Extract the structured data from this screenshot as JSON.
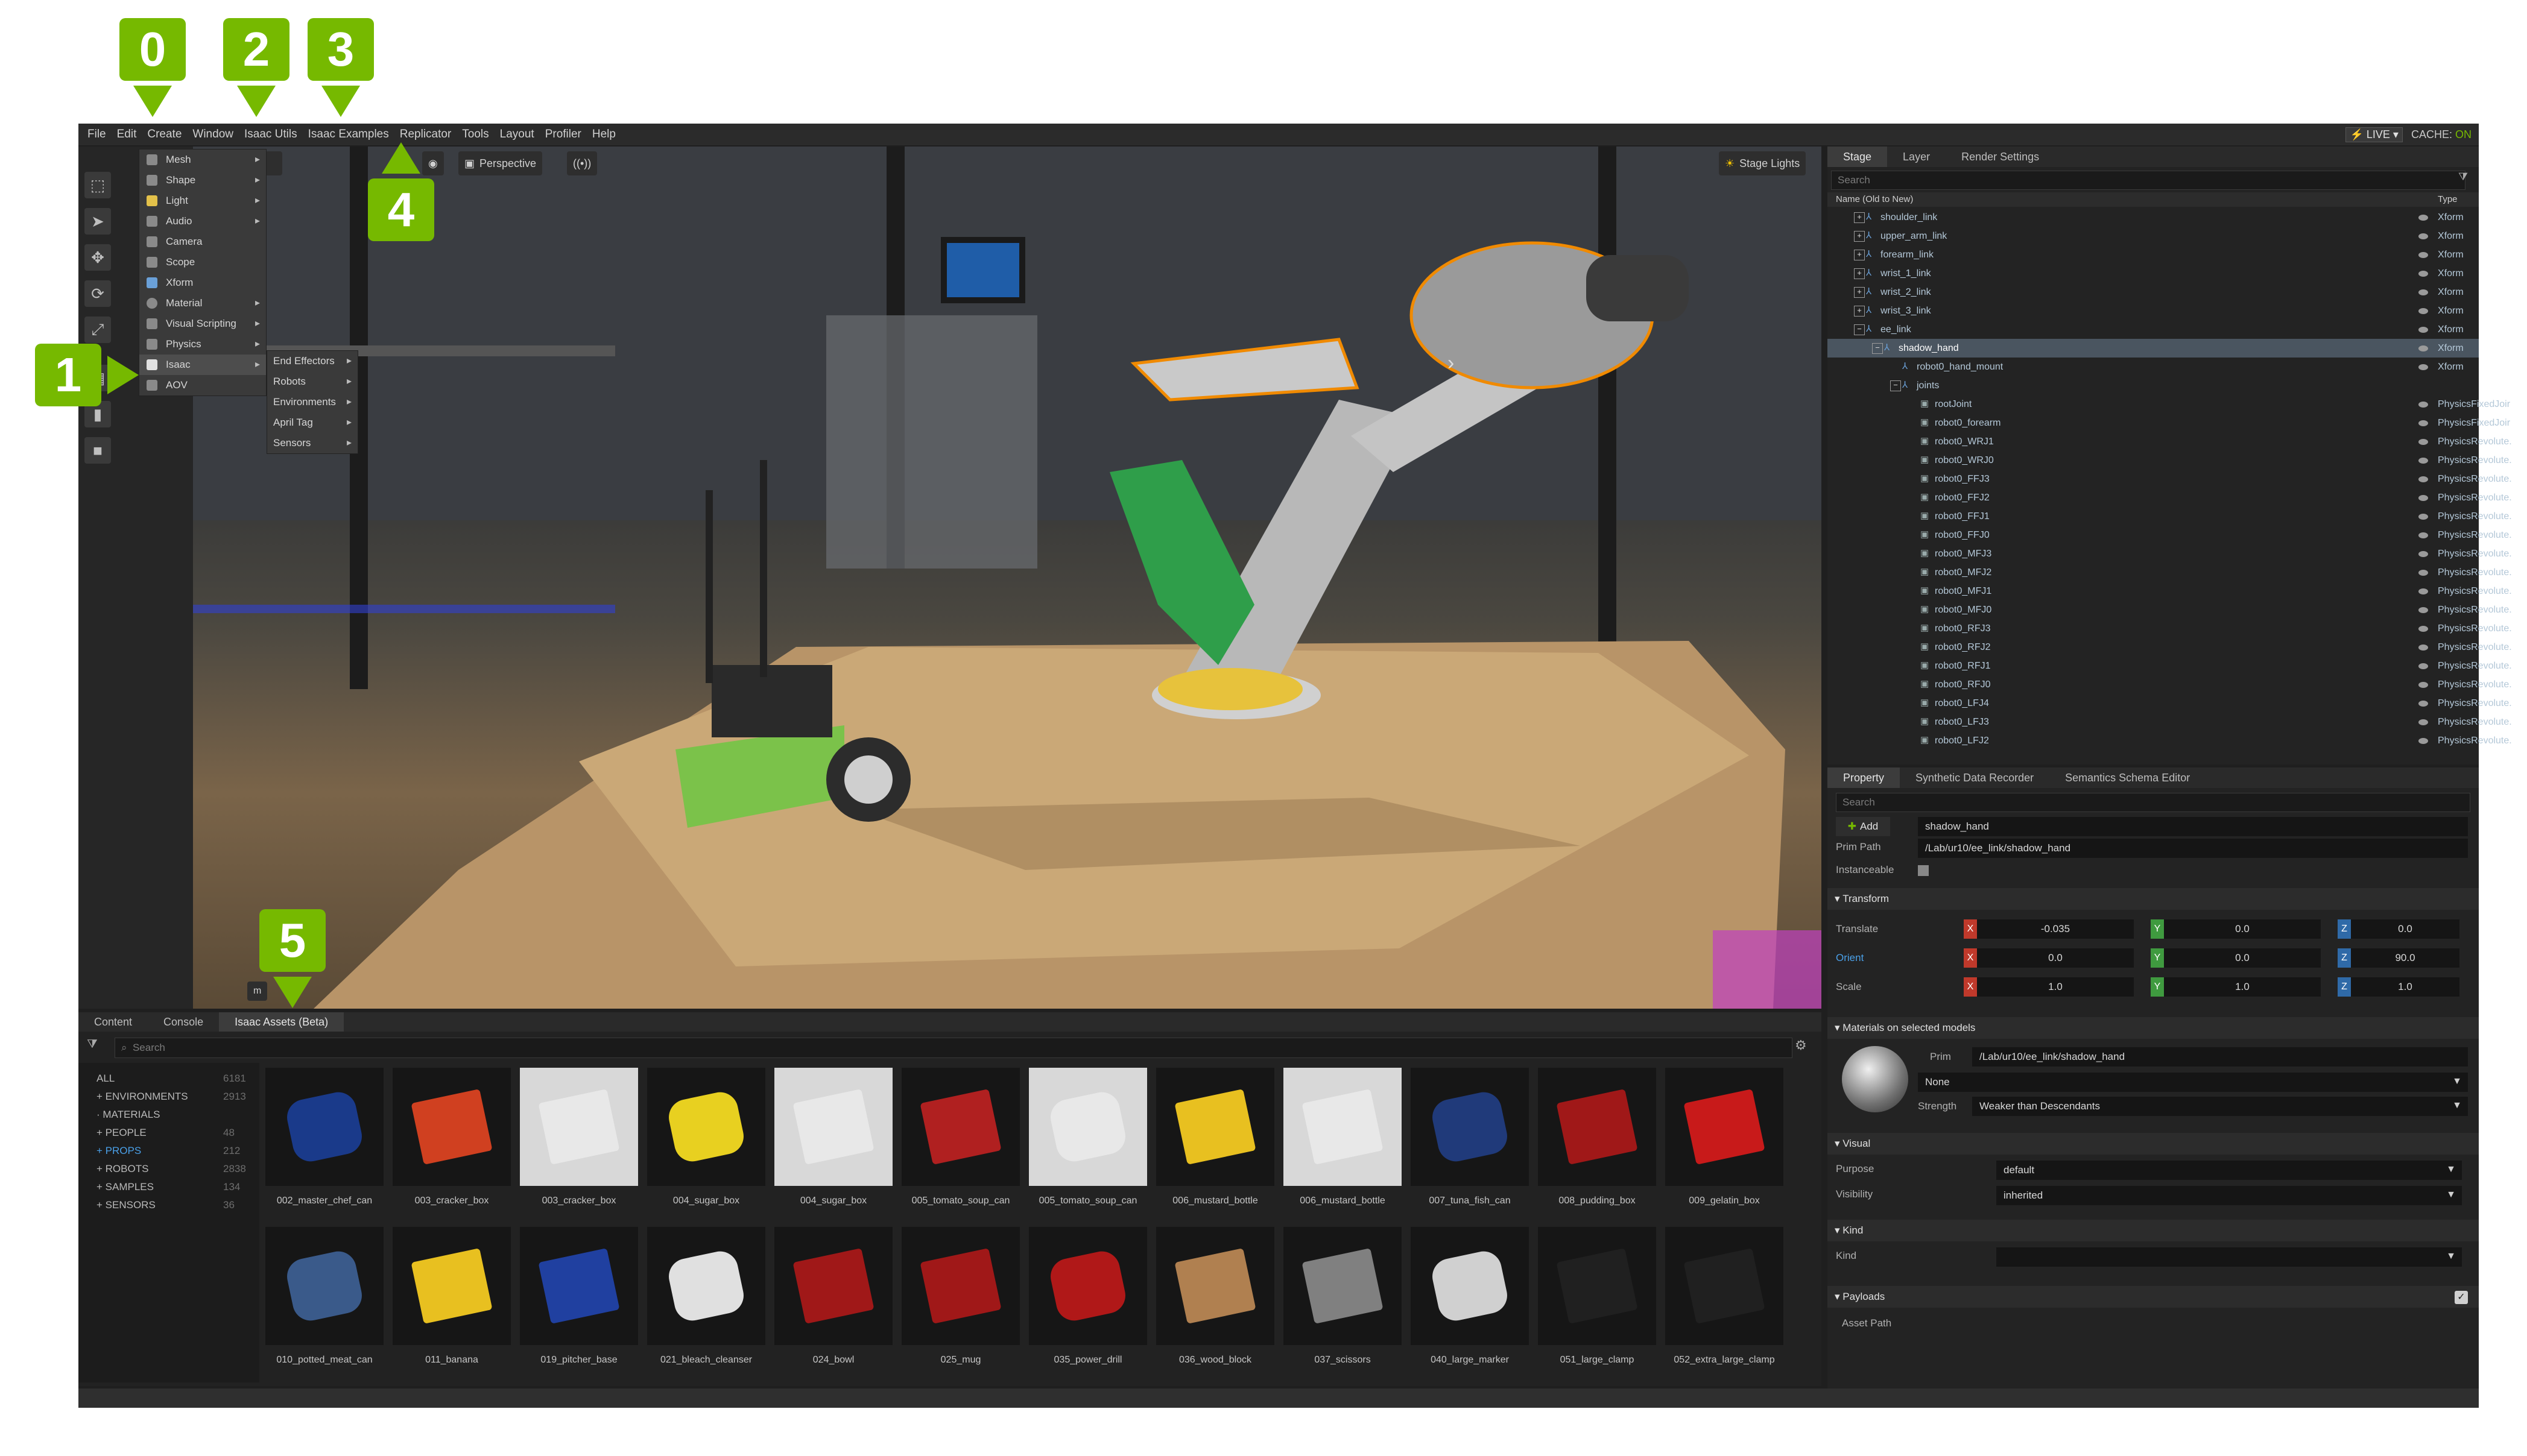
{
  "callouts": [
    "0",
    "1",
    "2",
    "3",
    "4",
    "5"
  ],
  "menubar": {
    "items": [
      "File",
      "Edit",
      "Create",
      "Window",
      "Isaac Utils",
      "Isaac Examples",
      "Replicator",
      "Tools",
      "Layout",
      "Profiler",
      "Help"
    ],
    "live": "LIVE",
    "cache_label": "CACHE:",
    "cache_state": "ON"
  },
  "create_menu": {
    "items": [
      {
        "label": "Mesh"
      },
      {
        "label": "Shape"
      },
      {
        "label": "Light"
      },
      {
        "label": "Audio"
      },
      {
        "label": "Camera"
      },
      {
        "label": "Scope"
      },
      {
        "label": "Xform"
      },
      {
        "label": "Material"
      },
      {
        "label": "Visual Scripting"
      },
      {
        "label": "Physics"
      },
      {
        "label": "Isaac"
      },
      {
        "label": "AOV"
      }
    ]
  },
  "isaac_submenu": {
    "items": [
      "End Effectors",
      "Robots",
      "Environments",
      "April Tag",
      "Sensors"
    ]
  },
  "viewport": {
    "camera_label": "Perspective",
    "stage_lights": "Stage Lights",
    "corner_label": "m"
  },
  "stage": {
    "tabs": [
      "Stage",
      "Layer",
      "Render Settings"
    ],
    "search_placeholder": "Search",
    "col_name": "Name (Old to New)",
    "col_type": "Type",
    "rows": [
      {
        "name": "shoulder_link",
        "type": "Xform"
      },
      {
        "name": "upper_arm_link",
        "type": "Xform"
      },
      {
        "name": "forearm_link",
        "type": "Xform"
      },
      {
        "name": "wrist_1_link",
        "type": "Xform"
      },
      {
        "name": "wrist_2_link",
        "type": "Xform"
      },
      {
        "name": "wrist_3_link",
        "type": "Xform"
      },
      {
        "name": "ee_link",
        "type": "Xform"
      },
      {
        "name": "shadow_hand",
        "type": "Xform"
      },
      {
        "name": "robot0_hand_mount",
        "type": "Xform"
      },
      {
        "name": "joints",
        "type": ""
      },
      {
        "name": "rootJoint",
        "type": "PhysicsFixedJoir"
      },
      {
        "name": "robot0_forearm",
        "type": "PhysicsFixedJoir"
      },
      {
        "name": "robot0_WRJ1",
        "type": "PhysicsRevolute."
      },
      {
        "name": "robot0_WRJ0",
        "type": "PhysicsRevolute."
      },
      {
        "name": "robot0_FFJ3",
        "type": "PhysicsRevolute."
      },
      {
        "name": "robot0_FFJ2",
        "type": "PhysicsRevolute."
      },
      {
        "name": "robot0_FFJ1",
        "type": "PhysicsRevolute."
      },
      {
        "name": "robot0_FFJ0",
        "type": "PhysicsRevolute."
      },
      {
        "name": "robot0_MFJ3",
        "type": "PhysicsRevolute."
      },
      {
        "name": "robot0_MFJ2",
        "type": "PhysicsRevolute."
      },
      {
        "name": "robot0_MFJ1",
        "type": "PhysicsRevolute."
      },
      {
        "name": "robot0_MFJ0",
        "type": "PhysicsRevolute."
      },
      {
        "name": "robot0_RFJ3",
        "type": "PhysicsRevolute."
      },
      {
        "name": "robot0_RFJ2",
        "type": "PhysicsRevolute."
      },
      {
        "name": "robot0_RFJ1",
        "type": "PhysicsRevolute."
      },
      {
        "name": "robot0_RFJ0",
        "type": "PhysicsRevolute."
      },
      {
        "name": "robot0_LFJ4",
        "type": "PhysicsRevolute."
      },
      {
        "name": "robot0_LFJ3",
        "type": "PhysicsRevolute."
      },
      {
        "name": "robot0_LFJ2",
        "type": "PhysicsRevolute."
      }
    ]
  },
  "property": {
    "tabs": [
      "Property",
      "Synthetic Data Recorder",
      "Semantics Schema Editor"
    ],
    "search_placeholder": "Search",
    "add_label": "Add",
    "name_value": "shadow_hand",
    "prim_path_label": "Prim Path",
    "prim_path_value": "/Lab/ur10/ee_link/shadow_hand",
    "instanceable_label": "Instanceable",
    "transform_header": "Transform",
    "translate_label": "Translate",
    "orient_label": "Orient",
    "scale_label": "Scale",
    "translate": [
      "-0.035",
      "0.0",
      "0.0"
    ],
    "orient": [
      "0.0",
      "0.0",
      "90.0"
    ],
    "scale": [
      "1.0",
      "1.0",
      "1.0"
    ],
    "axis_x": "X",
    "axis_y": "Y",
    "axis_z": "Z",
    "materials_header": "Materials on selected models",
    "prim_label": "Prim",
    "prim_value": "/Lab/ur10/ee_link/shadow_hand",
    "material_value": "None",
    "strength_label": "Strength",
    "strength_value": "Weaker than Descendants",
    "visual_header": "Visual",
    "purpose_label": "Purpose",
    "purpose_value": "default",
    "visibility_label": "Visibility",
    "visibility_value": "inherited",
    "kind_header": "Kind",
    "kind_label": "Kind",
    "payloads_header": "Payloads",
    "asset_path_label": "Asset Path"
  },
  "bottom": {
    "tabs": [
      "Content",
      "Console",
      "Isaac Assets (Beta)"
    ],
    "search_placeholder": "Search",
    "categories": [
      {
        "label": "ALL",
        "count": "6181"
      },
      {
        "label": "ENVIRONMENTS",
        "count": "2913"
      },
      {
        "label": "MATERIALS",
        "count": ""
      },
      {
        "label": "PEOPLE",
        "count": "48"
      },
      {
        "label": "PROPS",
        "count": "212"
      },
      {
        "label": "ROBOTS",
        "count": "2838"
      },
      {
        "label": "SAMPLES",
        "count": "134"
      },
      {
        "label": "SENSORS",
        "count": "36"
      }
    ],
    "assets_row1": [
      "002_master_chef_can",
      "003_cracker_box",
      "003_cracker_box",
      "004_sugar_box",
      "004_sugar_box",
      "005_tomato_soup_can",
      "005_tomato_soup_can",
      "006_mustard_bottle",
      "006_mustard_bottle",
      "007_tuna_fish_can",
      "008_pudding_box",
      "009_gelatin_box"
    ],
    "assets_row2": [
      "010_potted_meat_can",
      "011_banana",
      "019_pitcher_base",
      "021_bleach_cleanser",
      "024_bowl",
      "025_mug",
      "035_power_drill",
      "036_wood_block",
      "037_scissors",
      "040_large_marker",
      "051_large_clamp",
      "052_extra_large_clamp"
    ]
  },
  "colors": {
    "accent": "#76b900",
    "selection": "#4a5560",
    "link": "#4aa0e8",
    "axis_x": "#c0392b",
    "axis_y": "#3f9a3f",
    "axis_z": "#2f6aa8"
  }
}
